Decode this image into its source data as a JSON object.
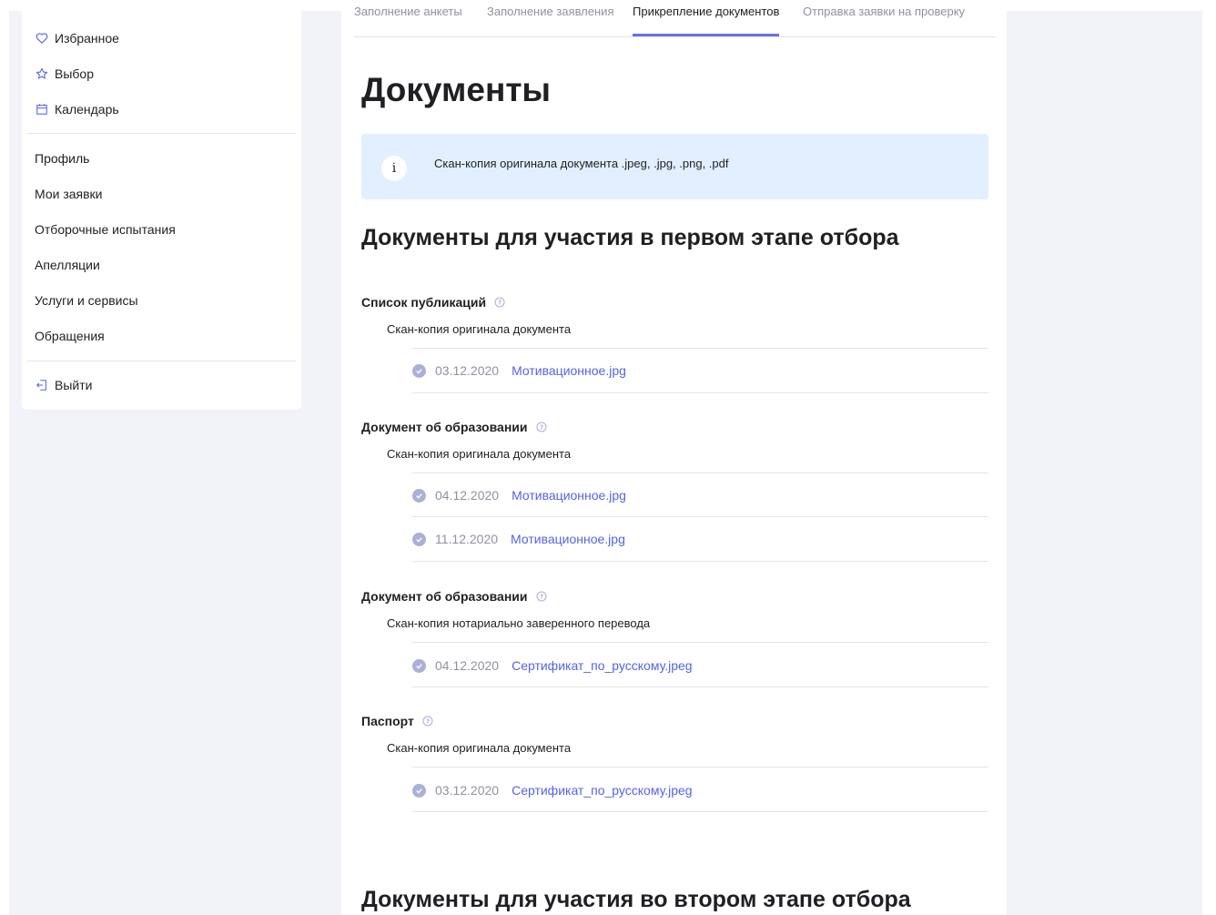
{
  "sidebar": {
    "top_items": [
      {
        "label": "Избранное",
        "icon": "heart-icon"
      },
      {
        "label": "Выбор",
        "icon": "star-icon"
      },
      {
        "label": "Календарь",
        "icon": "calendar-icon"
      }
    ],
    "nav_items": [
      {
        "label": "Профиль"
      },
      {
        "label": "Мои заявки"
      },
      {
        "label": "Отборочные испытания"
      },
      {
        "label": "Апелляции"
      },
      {
        "label": "Услуги и сервисы"
      },
      {
        "label": "Обращения"
      }
    ],
    "logout": {
      "label": "Выйти",
      "icon": "logout-icon"
    }
  },
  "tabs": [
    {
      "label": "Заполнение анкеты",
      "active": false
    },
    {
      "label": "Заполнение заявления",
      "active": false
    },
    {
      "label": "Прикрепление документов",
      "active": true
    },
    {
      "label": "Отправка заявки на проверку",
      "active": false
    }
  ],
  "page_title": "Документы",
  "info": {
    "icon": "info-icon",
    "text": "Скан-копия оригинала документа .jpeg, .jpg, .png, .pdf"
  },
  "section_first": {
    "title": "Документы для участия в первом этапе отбора",
    "groups": [
      {
        "title": "Список публикаций",
        "subtitle": "Скан-копия оригинала документа",
        "files": [
          {
            "date": "03.12.2020",
            "name": "Мотивационное.jpg"
          }
        ]
      },
      {
        "title": "Документ об образовании",
        "subtitle": "Скан-копия оригинала документа",
        "files": [
          {
            "date": "04.12.2020",
            "name": "Мотивационное.jpg"
          },
          {
            "date": "11.12.2020",
            "name": "Мотивационное.jpg"
          }
        ]
      },
      {
        "title": "Документ об образовании",
        "subtitle": "Скан-копия нотариально заверенного перевода",
        "files": [
          {
            "date": "04.12.2020",
            "name": "Сертификат_по_русскому.jpeg"
          }
        ]
      },
      {
        "title": "Паспорт",
        "subtitle": "Скан-копия оригинала документа",
        "files": [
          {
            "date": "03.12.2020",
            "name": "Сертификат_по_русскому.jpeg"
          }
        ]
      }
    ]
  },
  "section_second": {
    "title": "Документы для участия во втором этапе отбора"
  },
  "colors": {
    "accent": "#6770e6",
    "link": "#5563e8",
    "info_bg": "#e1efff",
    "page_bg": "#f2f3f8"
  }
}
